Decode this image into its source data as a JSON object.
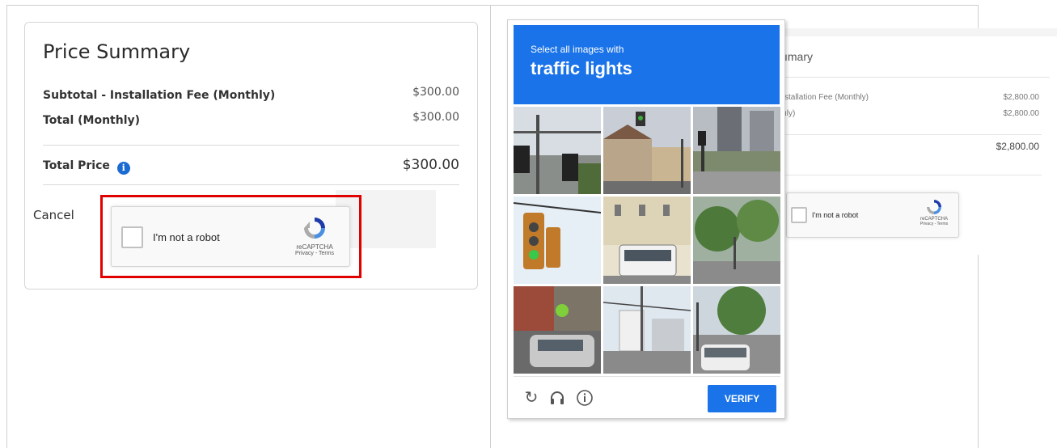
{
  "left": {
    "title": "Price Summary",
    "rows": [
      {
        "label": "Subtotal - Installation Fee (Monthly)",
        "amount": "$300.00"
      },
      {
        "label": "Total (Monthly)",
        "amount": "$300.00"
      }
    ],
    "total": {
      "label": "Total Price",
      "amount": "$300.00"
    },
    "cancel_label": "Cancel",
    "recaptcha": {
      "label": "I'm not a robot",
      "brand": "reCAPTCHA",
      "terms": "Privacy - Terms"
    }
  },
  "right": {
    "bg_title": "ımary",
    "rows": [
      {
        "label": "stallation Fee (Monthly)",
        "amount": "$2,800.00"
      },
      {
        "label": "ıly)",
        "amount": "$2,800.00"
      }
    ],
    "total_amount": "$2,800.00",
    "recaptcha": {
      "label": "I'm not a robot",
      "brand": "reCAPTCHA",
      "terms": "Privacy - Terms"
    },
    "challenge": {
      "instruction": "Select all images with",
      "target": "traffic lights",
      "verify_label": "VERIFY",
      "tiles": [
        "traffic light on pole",
        "street with houses",
        "city square",
        "traffic lights closeup",
        "trolleybus street",
        "street trees",
        "cyclist with car",
        "road with buildings",
        "car on road"
      ],
      "footer_icons": [
        "reload-icon",
        "audio-icon",
        "info-icon"
      ]
    }
  },
  "colors": {
    "accent": "#1a73e8",
    "highlight": "#e00000",
    "info": "#1b6bd3"
  }
}
